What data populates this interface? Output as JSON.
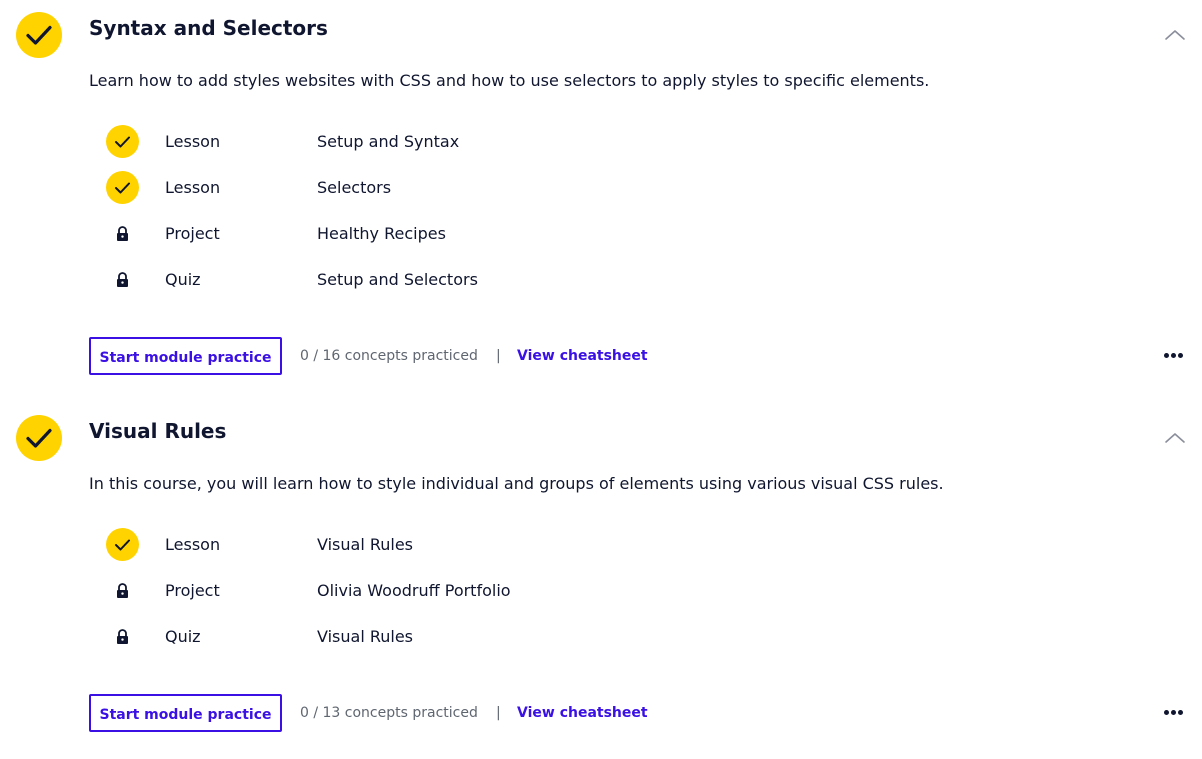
{
  "modules": [
    {
      "title": "Syntax and Selectors",
      "description": "Learn how to add styles websites with CSS and how to use selectors to apply styles to specific elements.",
      "completed": true,
      "items": [
        {
          "type": "Lesson",
          "title": "Setup and Syntax",
          "status": "completed"
        },
        {
          "type": "Lesson",
          "title": "Selectors",
          "status": "completed"
        },
        {
          "type": "Project",
          "title": "Healthy Recipes",
          "status": "locked"
        },
        {
          "type": "Quiz",
          "title": "Setup and Selectors",
          "status": "locked"
        }
      ],
      "practice_label": "Start module practice",
      "concepts_text": "0 / 16 concepts practiced",
      "separator": "|",
      "cheatsheet_label": "View cheatsheet"
    },
    {
      "title": "Visual Rules",
      "description": "In this course, you will learn how to style individual and groups of elements using various visual CSS rules.",
      "completed": true,
      "items": [
        {
          "type": "Lesson",
          "title": "Visual Rules",
          "status": "completed"
        },
        {
          "type": "Project",
          "title": "Olivia Woodruff Portfolio",
          "status": "locked"
        },
        {
          "type": "Quiz",
          "title": "Visual Rules",
          "status": "locked"
        }
      ],
      "practice_label": "Start module practice",
      "concepts_text": "0 / 13 concepts practiced",
      "separator": "|",
      "cheatsheet_label": "View cheatsheet"
    }
  ],
  "colors": {
    "check_yellow": "#ffd300",
    "accent_purple": "#3a10e5",
    "text_navy": "#10162f",
    "muted_gray": "#5f6670"
  },
  "icons": {
    "completed": "checkmark-icon",
    "locked": "lock-icon",
    "collapse": "chevron-up-icon",
    "more": "more-options-icon"
  }
}
